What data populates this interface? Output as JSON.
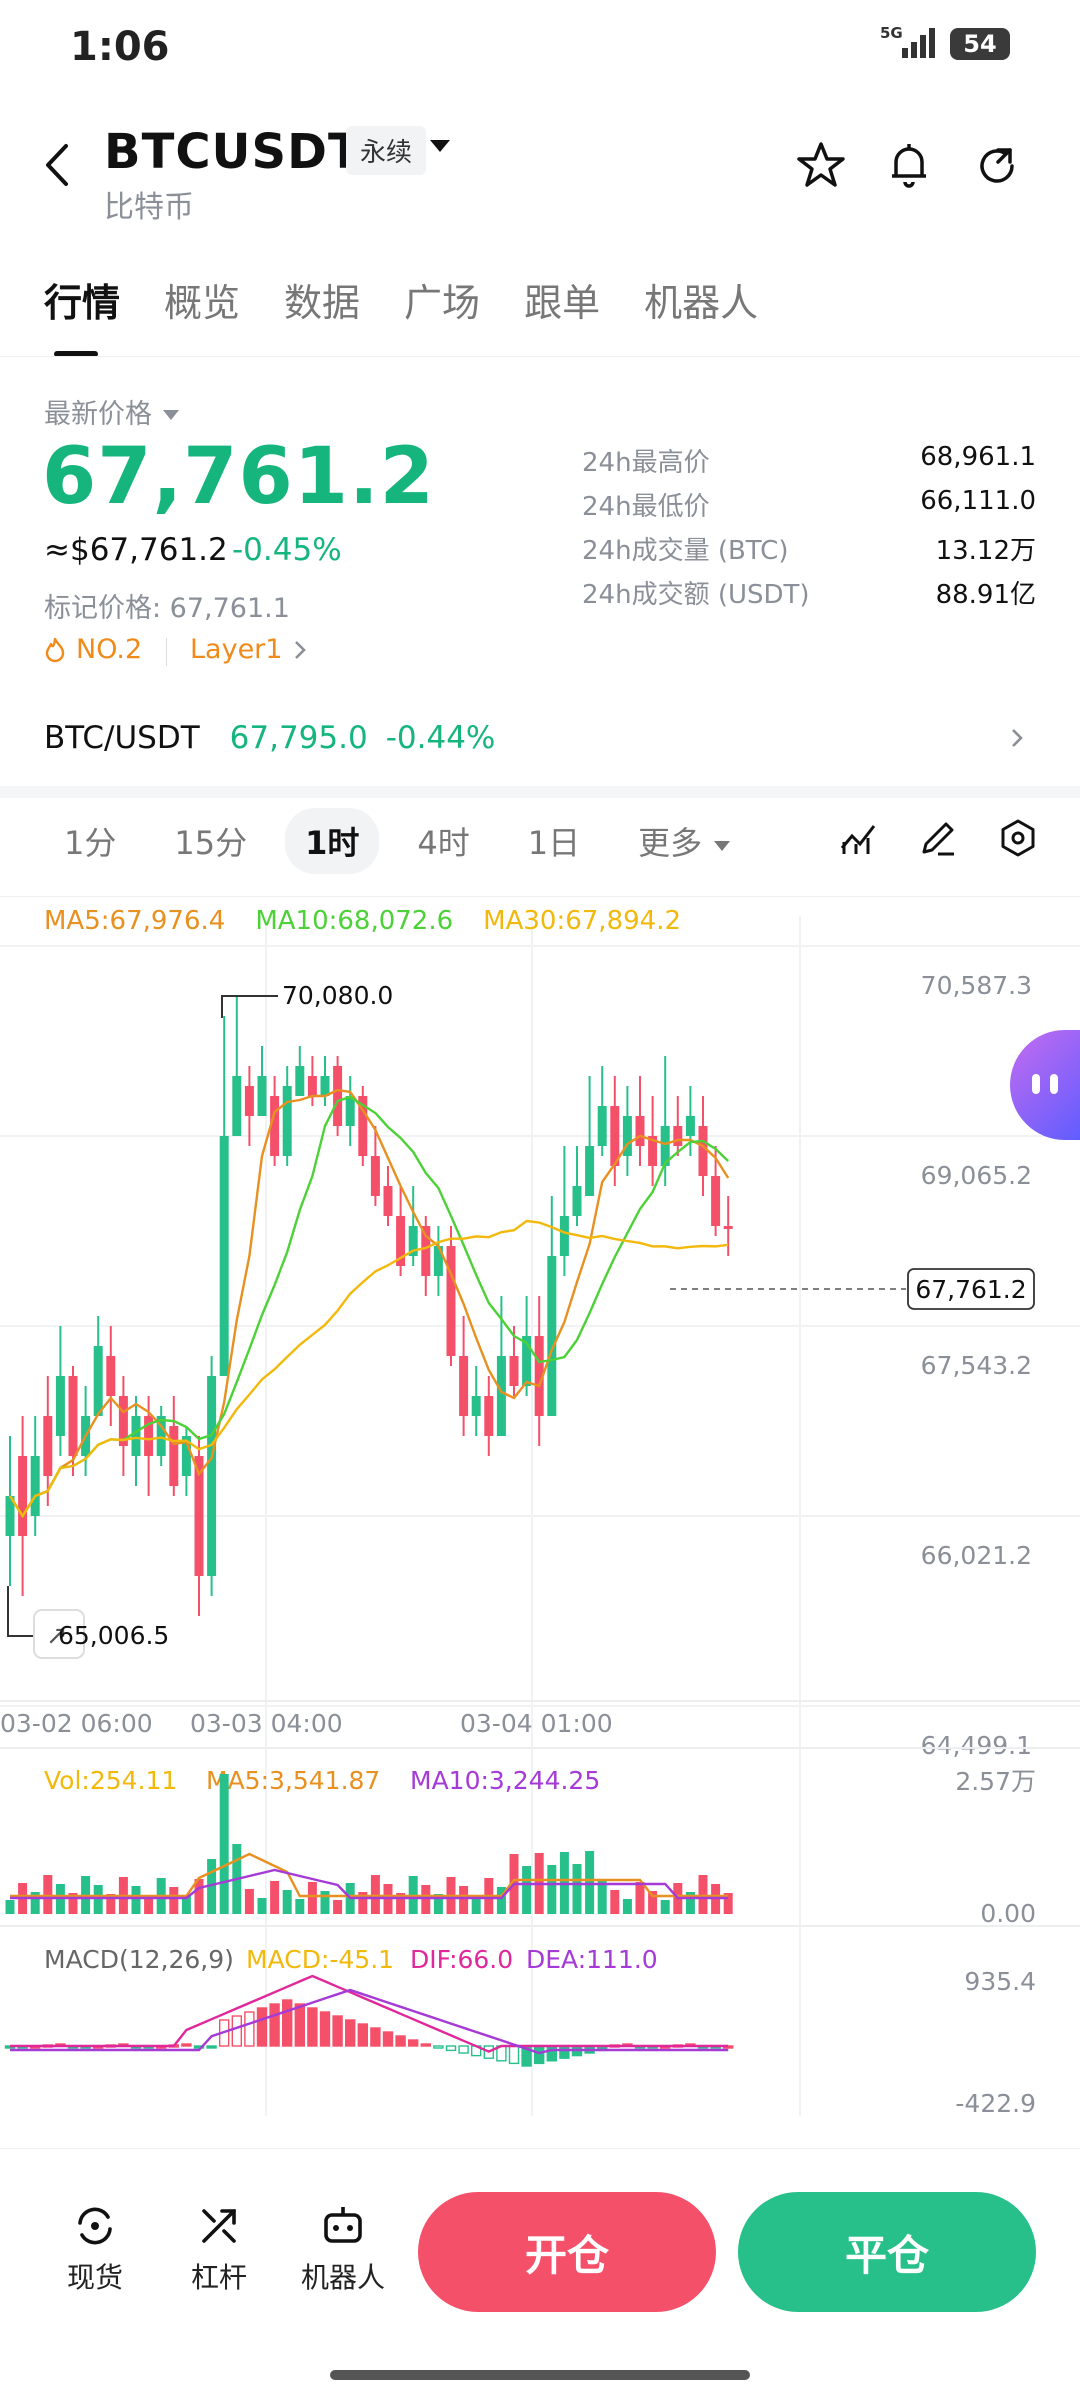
{
  "status": {
    "time": "1:06",
    "network": "5G",
    "battery": "54"
  },
  "header": {
    "symbol": "BTCUSDT",
    "badge": "永续",
    "subtitle": "比特币"
  },
  "tabs": [
    "行情",
    "概览",
    "数据",
    "广场",
    "跟单",
    "机器人"
  ],
  "price_block": {
    "latest_label": "最新价格",
    "price": "67,761.2",
    "usd_price": "≈$67,761.2",
    "change": "-0.45%",
    "mark_price": "标记价格: 67,761.1",
    "rank": "NO.2",
    "sector": "Layer1"
  },
  "stats": [
    {
      "label": "24h最高价",
      "value": "68,961.1"
    },
    {
      "label": "24h最低价",
      "value": "66,111.0"
    },
    {
      "label": "24h成交量 (BTC)",
      "value": "13.12万"
    },
    {
      "label": "24h成交额 (USDT)",
      "value": "88.91亿"
    }
  ],
  "spot": {
    "pair": "BTC/USDT",
    "price": "67,795.0",
    "change": "-0.44%"
  },
  "intervals": {
    "items": [
      "1分",
      "15分",
      "1时",
      "4时",
      "1日"
    ],
    "active": "1时",
    "more": "更多"
  },
  "ma_legend": {
    "ma5": "MA5:67,976.4",
    "ma10": "MA10:68,072.6",
    "ma30": "MA30:67,894.2"
  },
  "price_axis": [
    "70,587.3",
    "69,065.2",
    "67,543.2",
    "66,021.2",
    "64,499.1"
  ],
  "current_price_tag": "67,761.2",
  "high_marker": "70,080.0",
  "low_marker": "65,006.5",
  "time_axis": [
    "03-02 06:00",
    "03-03 04:00",
    "03-04 01:00"
  ],
  "volume": {
    "vol": "Vol:254.11",
    "ma5": "MA5:3,541.87",
    "ma10": "MA10:3,244.25",
    "axis_top": "2.57万",
    "axis_bottom": "0.00"
  },
  "macd": {
    "params": "MACD(12,26,9)",
    "macd": "MACD:-45.1",
    "dif": "DIF:66.0",
    "dea": "DEA:111.0",
    "axis_top": "935.4",
    "axis_bottom": "-422.9"
  },
  "bottom_nav": [
    {
      "label": "现货",
      "icon": "spot-icon"
    },
    {
      "label": "杠杆",
      "icon": "leverage-icon"
    },
    {
      "label": "机器人",
      "icon": "robot-icon"
    }
  ],
  "actions": {
    "open": "开仓",
    "close": "平仓"
  },
  "colors": {
    "up": "#27c08a",
    "down": "#f5506a",
    "ma5": "#e89020",
    "ma10": "#4cd137",
    "ma30": "#f2b90c"
  }
}
